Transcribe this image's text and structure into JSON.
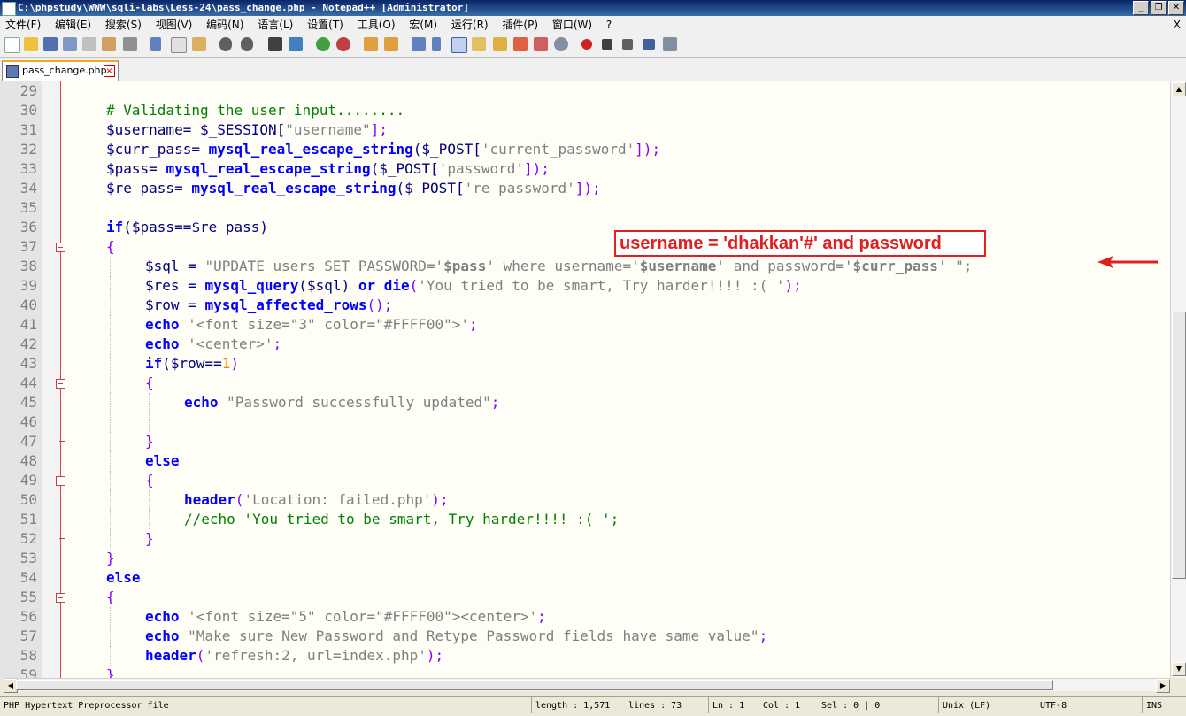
{
  "window": {
    "title": "C:\\phpstudy\\WWW\\sqli-labs\\Less-24\\pass_change.php - Notepad++ [Administrator]",
    "min": "_",
    "max": "❐",
    "close": "✕"
  },
  "menu": {
    "items": [
      "文件(F)",
      "编辑(E)",
      "搜索(S)",
      "视图(V)",
      "编码(N)",
      "语言(L)",
      "设置(T)",
      "工具(O)",
      "宏(M)",
      "运行(R)",
      "插件(P)",
      "窗口(W)",
      "?"
    ],
    "close": "X"
  },
  "tab": {
    "label": "pass_change.php",
    "close": "×"
  },
  "annotation": "username = 'dhakkan'#' and password",
  "code_lines": [
    "29",
    "30",
    "31",
    "32",
    "33",
    "34",
    "35",
    "36",
    "37",
    "38",
    "39",
    "40",
    "41",
    "42",
    "43",
    "44",
    "45",
    "46",
    "47",
    "48",
    "49",
    "50",
    "51",
    "52",
    "53",
    "54",
    "55",
    "56",
    "57",
    "58",
    "59"
  ],
  "code": {
    "l30": "# Validating the user input........",
    "l31a": "$username= $_SESSION[",
    "l31b": "\"username\"",
    "l31c": "];",
    "l32a": "$curr_pass= ",
    "l32b": "mysql_real_escape_string",
    "l32c": "($_POST[",
    "l32d": "'current_password'",
    "l32e": "]);",
    "l33a": "$pass= ",
    "l33b": "mysql_real_escape_string",
    "l33c": "($_POST[",
    "l33d": "'password'",
    "l33e": "]);",
    "l34a": "$re_pass= ",
    "l34b": "mysql_real_escape_string",
    "l34c": "($_POST[",
    "l34d": "'re_password'",
    "l34e": "]);",
    "l36a": "if",
    "l36b": "($pass==$re_pass)",
    "l37": "{",
    "l38a": "$sql = ",
    "l38b": "\"UPDATE users SET PASSWORD='",
    "l38c": "$pass",
    "l38d": "' where username='",
    "l38e": "$username",
    "l38f": "' and password='",
    "l38g": "$curr_pass",
    "l38h": "' \";",
    "l39a": "$res = ",
    "l39b": "mysql_query",
    "l39c": "($sql) ",
    "l39d": "or die",
    "l39e": "(",
    "l39f": "'You tried to be smart, Try harder!!!! :( '",
    "l39g": ");",
    "l40a": "$row = ",
    "l40b": "mysql_affected_rows",
    "l40c": "();",
    "l41a": "echo",
    "l41b": " '<font size=\"3\" color=\"#FFFF00\">'",
    "l41c": ";",
    "l42a": "echo",
    "l42b": " '<center>'",
    "l42c": ";",
    "l43a": "if",
    "l43b": "($row==",
    "l43c": "1",
    "l43d": ")",
    "l44": "{",
    "l45a": "echo",
    "l45b": " \"Password successfully updated\"",
    "l45c": ";",
    "l47": "}",
    "l48": "else",
    "l49": "{",
    "l50a": "header",
    "l50b": "(",
    "l50c": "'Location: failed.php'",
    "l50d": ");",
    "l51": "//echo 'You tried to be smart, Try harder!!!! :( ';",
    "l52": "}",
    "l53": "}",
    "l54": "else",
    "l55": "{",
    "l56a": "echo",
    "l56b": " '<font size=\"5\" color=\"#FFFF00\"><center>'",
    "l56c": ";",
    "l57a": "echo",
    "l57b": " \"Make sure New Password and Retype Password fields have same value\"",
    "l57c": ";",
    "l58a": "header",
    "l58b": "(",
    "l58c": "'refresh:2, url=index.php'",
    "l58d": ");",
    "l59": "}"
  },
  "status": {
    "file_type": "PHP Hypertext Preprocessor file",
    "length": "length : 1,571",
    "lines": "lines : 73",
    "ln": "Ln : 1",
    "col": "Col : 1",
    "sel": "Sel : 0 | 0",
    "eol": "Unix (LF)",
    "encoding": "UTF-8",
    "ins": "INS"
  },
  "colors": {
    "keyword": "#0000ff",
    "comment": "#008000",
    "string": "#808080",
    "annotation": "#e02020"
  }
}
